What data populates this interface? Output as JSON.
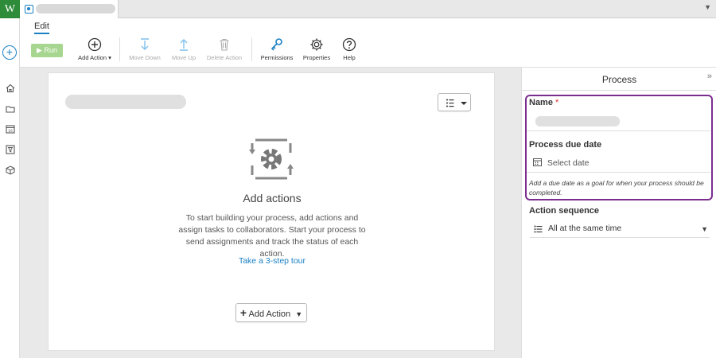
{
  "app": {
    "logo": "W"
  },
  "tabbar": {
    "doc_icon": "process-icon",
    "menu_caret": "▼"
  },
  "rail": {
    "add_symbol": "+",
    "items": [
      {
        "icon": "home-icon"
      },
      {
        "icon": "folder-icon"
      },
      {
        "icon": "calendar-icon"
      },
      {
        "icon": "filter-icon"
      },
      {
        "icon": "cube-icon"
      }
    ]
  },
  "ribbon": {
    "tab": "Edit",
    "run": "Run",
    "add_action": "Add Action",
    "move_down": "Move Down",
    "move_up": "Move Up",
    "delete_action": "Delete Action",
    "permissions": "Permissions",
    "properties": "Properties",
    "help": "Help"
  },
  "main": {
    "empty_title": "Add actions",
    "empty_desc": "To start building your process, add actions and assign tasks to collaborators. Start your process to send assignments and track the status of each action.",
    "tour_link": "Take a 3-step tour",
    "add_action_button": "Add Action"
  },
  "panel": {
    "title": "Process",
    "name_label": "Name",
    "required_mark": "*",
    "due_date_label": "Process due date",
    "due_date_placeholder": "Select date",
    "due_date_hint": "Add a due date as a goal for when your process should be completed.",
    "sequence_label": "Action sequence",
    "sequence_value": "All at the same time"
  },
  "colors": {
    "accent": "#1a7fc4",
    "brand": "#2e8b3a",
    "highlight": "#7b2d8e",
    "run": "#a6d68f"
  }
}
